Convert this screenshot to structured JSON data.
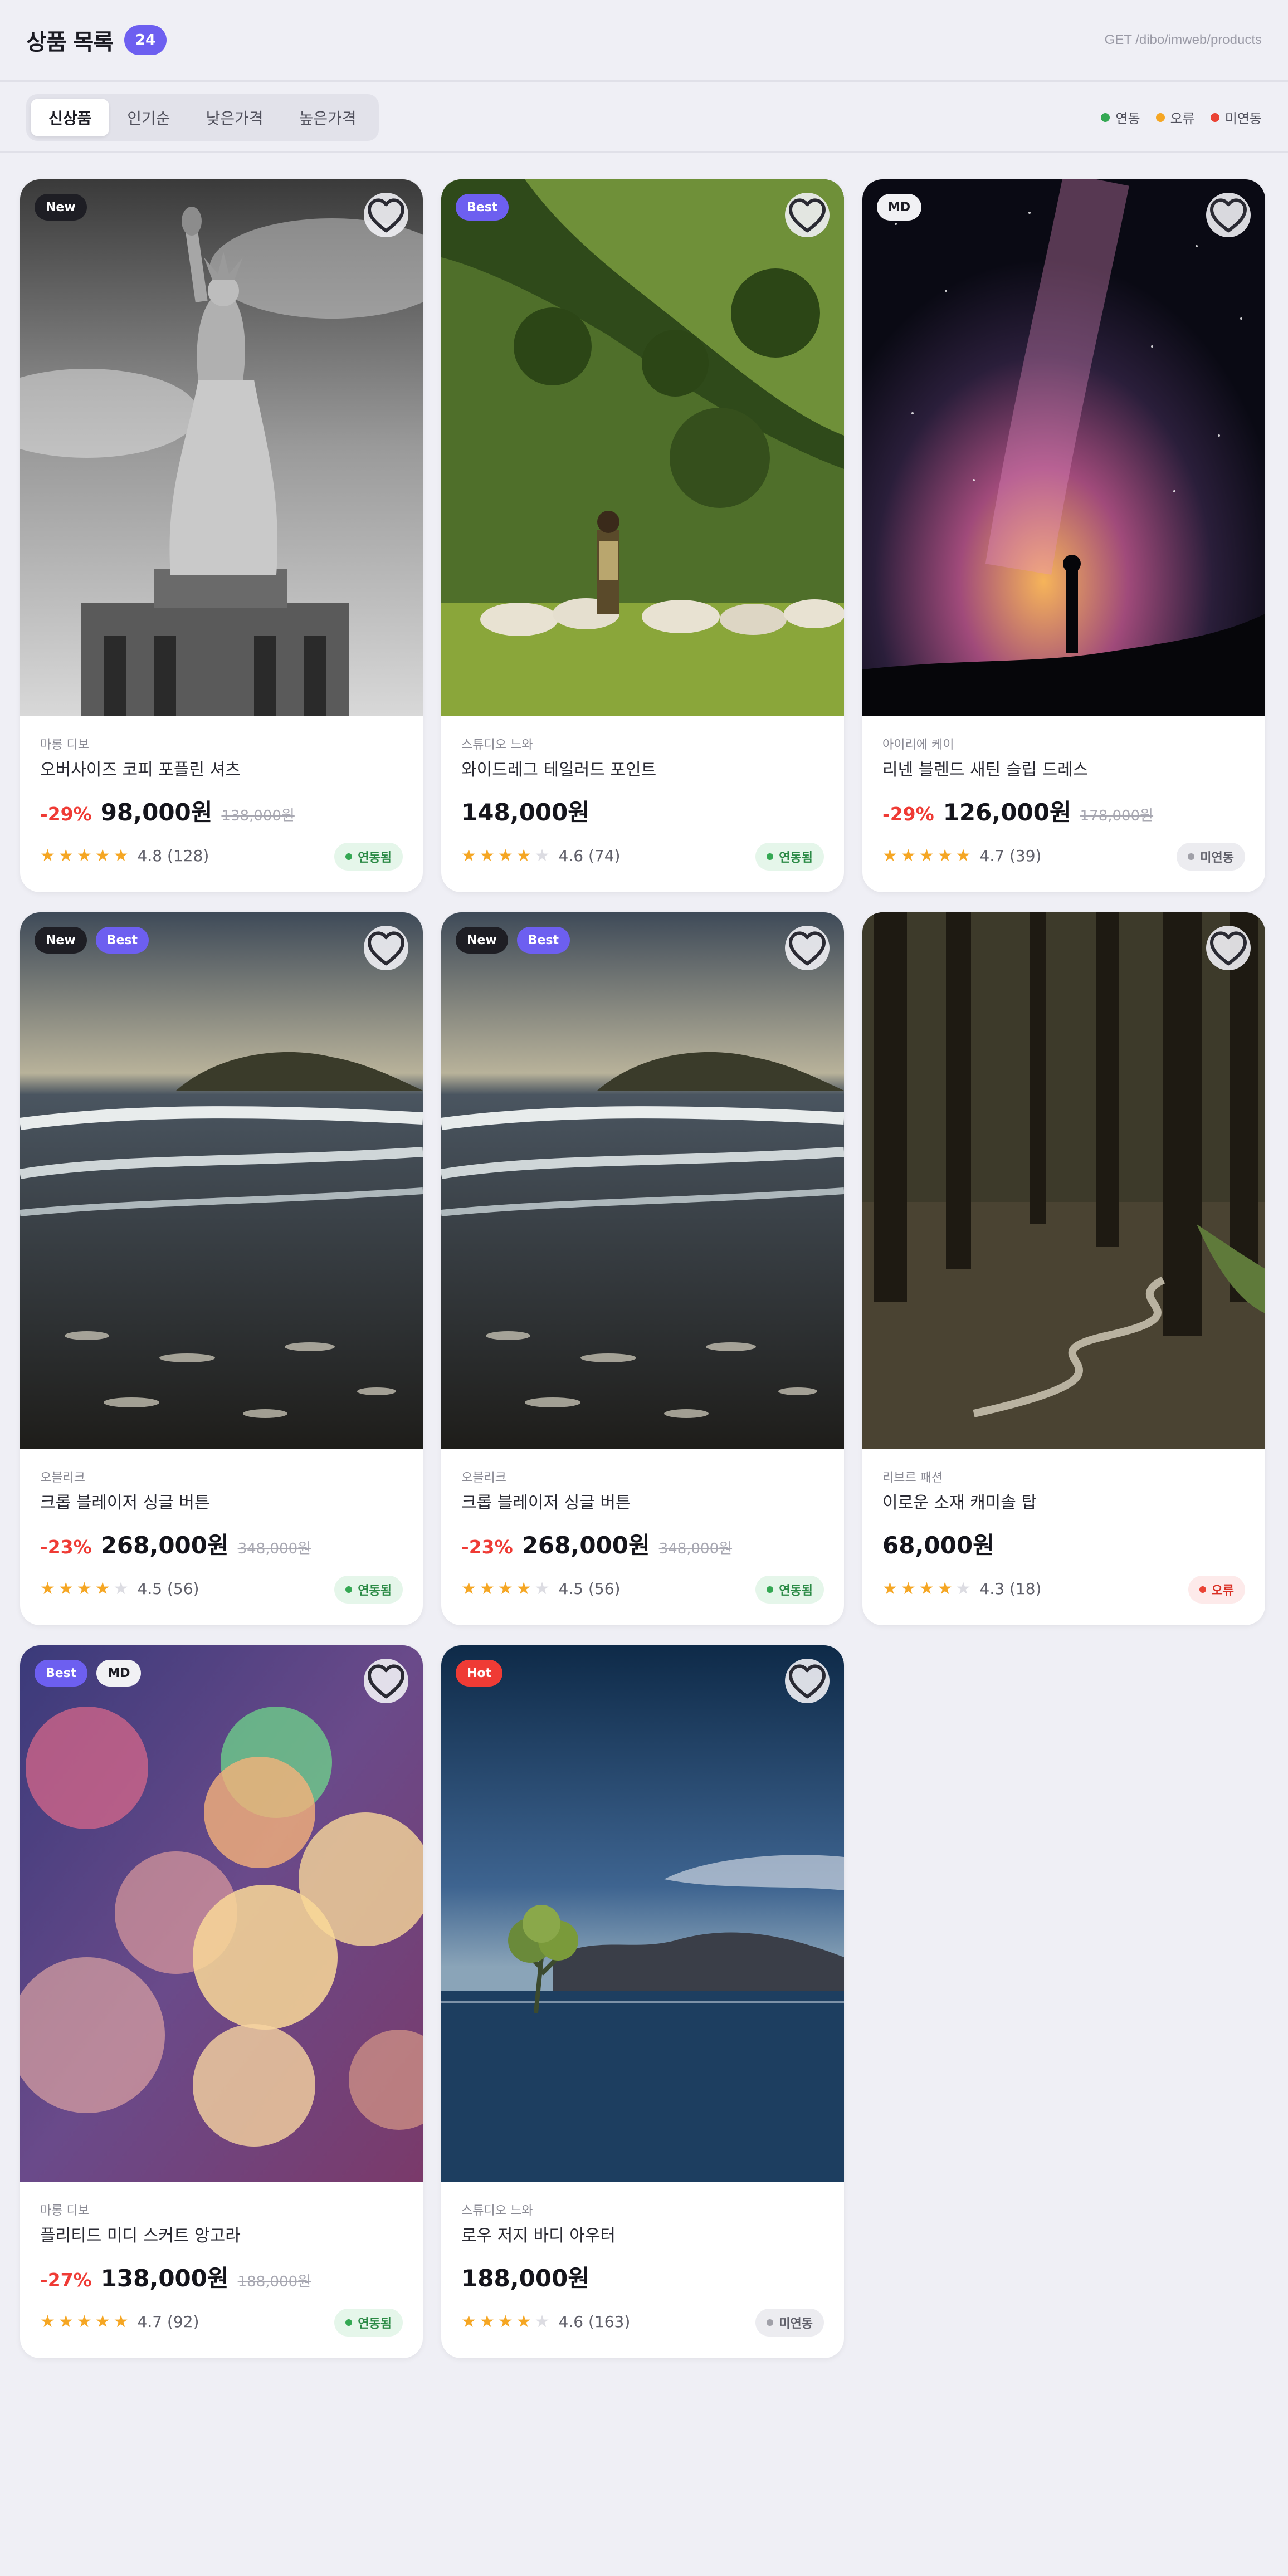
{
  "header": {
    "title": "상품 목록",
    "count": "24",
    "endpoint": "GET /dibo/imweb/products"
  },
  "tabs": [
    {
      "label": "신상품",
      "active": true
    },
    {
      "label": "인기순",
      "active": false
    },
    {
      "label": "낮은가격",
      "active": false
    },
    {
      "label": "높은가격",
      "active": false
    }
  ],
  "legend": [
    {
      "label": "연동",
      "color": "#34a853"
    },
    {
      "label": "오류",
      "color": "#f5a623"
    },
    {
      "label": "미연동",
      "color": "#ea4335"
    }
  ],
  "products": [
    {
      "badges": [
        "New"
      ],
      "brand": "마롱 디보",
      "name": "오버사이즈 코피 포플린 셔츠",
      "discount": "-29%",
      "price": "98,000원",
      "original": "138,000원",
      "rating": 4.8,
      "rating_text": "4.8 (128)",
      "status": "연동됨",
      "status_kind": "ok",
      "image": "statue-icon"
    },
    {
      "badges": [
        "Best"
      ],
      "brand": "스튜디오 느와",
      "name": "와이드레그 테일러드 포인트",
      "discount": "",
      "price": "148,000원",
      "original": "",
      "rating": 4.6,
      "rating_text": "4.6 (74)",
      "status": "연동됨",
      "status_kind": "ok",
      "image": "pasture-icon"
    },
    {
      "badges": [
        "MD"
      ],
      "brand": "아이리에 케이",
      "name": "리넨 블렌드 새틴 슬립 드레스",
      "discount": "-29%",
      "price": "126,000원",
      "original": "178,000원",
      "rating": 4.7,
      "rating_text": "4.7 (39)",
      "status": "미연동",
      "status_kind": "none",
      "image": "milkyway-icon"
    },
    {
      "badges": [
        "New",
        "Best"
      ],
      "brand": "오블리크",
      "name": "크롭 블레이저 싱글 버튼",
      "discount": "-23%",
      "price": "268,000원",
      "original": "348,000원",
      "rating": 4.5,
      "rating_text": "4.5 (56)",
      "status": "연동됨",
      "status_kind": "ok",
      "image": "beach-icon"
    },
    {
      "badges": [
        "New",
        "Best"
      ],
      "brand": "오블리크",
      "name": "크롭 블레이저 싱글 버튼",
      "discount": "-23%",
      "price": "268,000원",
      "original": "348,000원",
      "rating": 4.5,
      "rating_text": "4.5 (56)",
      "status": "연동됨",
      "status_kind": "ok",
      "image": "beach-icon"
    },
    {
      "badges": [],
      "brand": "리브르 패션",
      "name": "이로운 소재 캐미솔 탑",
      "discount": "",
      "price": "68,000원",
      "original": "",
      "rating": 4.3,
      "rating_text": "4.3 (18)",
      "status": "오류",
      "status_kind": "err",
      "image": "forest-icon"
    },
    {
      "badges": [
        "Best",
        "MD"
      ],
      "brand": "마롱 디보",
      "name": "플리티드 미디 스커트 앙고라",
      "discount": "-27%",
      "price": "138,000원",
      "original": "188,000원",
      "rating": 4.7,
      "rating_text": "4.7 (92)",
      "status": "연동됨",
      "status_kind": "ok",
      "image": "bokeh-icon"
    },
    {
      "badges": [
        "Hot"
      ],
      "brand": "스튜디오 느와",
      "name": "로우 저지 바디 아우터",
      "discount": "",
      "price": "188,000원",
      "original": "",
      "rating": 4.6,
      "rating_text": "4.6 (163)",
      "status": "미연동",
      "status_kind": "none",
      "image": "lake-tree-icon"
    }
  ]
}
